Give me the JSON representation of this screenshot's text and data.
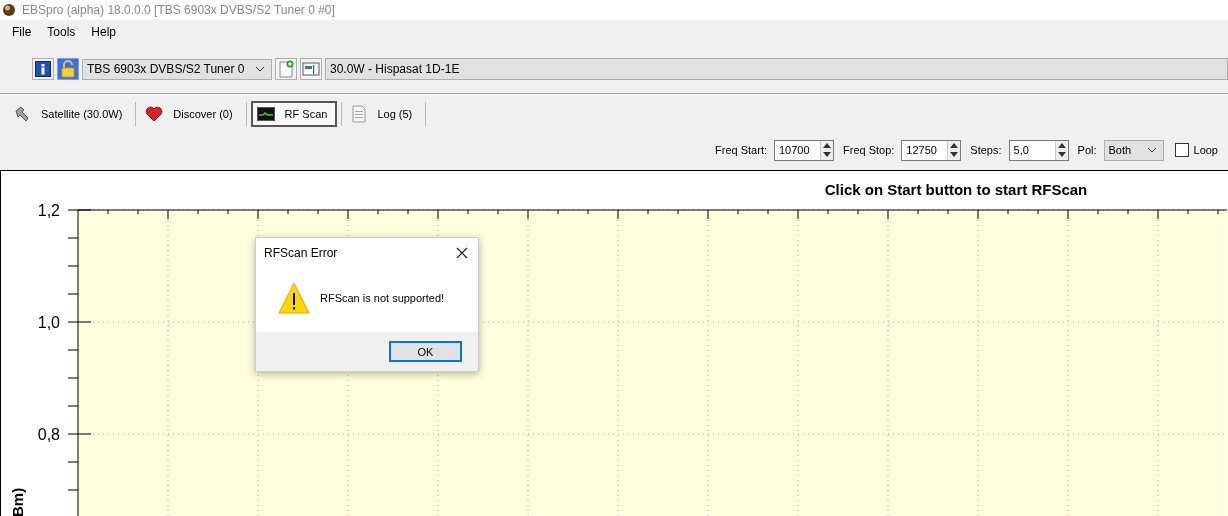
{
  "window": {
    "title": "EBSpro (alpha) 18.0.0.0 [TBS 6903x DVBS/S2 Tuner 0 #0]"
  },
  "menu": [
    "File",
    "Tools",
    "Help"
  ],
  "toolbar": {
    "buttons": [
      {
        "kind": "info",
        "on": false
      },
      {
        "kind": "lock",
        "on": true
      }
    ],
    "tuner": "TBS 6903x DVBS/S2 Tuner 0",
    "actions": [
      {
        "kind": "new"
      },
      {
        "kind": "position"
      }
    ],
    "satellite": "30.0W - Hispasat 1D-1E"
  },
  "tabs": [
    {
      "kind": "satellite",
      "label": "Satellite (30.0W)",
      "selected": false
    },
    {
      "kind": "discover",
      "label": "Discover (0)",
      "selected": false
    },
    {
      "kind": "rfscan",
      "label": "RF Scan",
      "selected": true
    },
    {
      "kind": "log",
      "label": "Log (5)",
      "selected": false
    }
  ],
  "scan_settings": {
    "fields": [
      {
        "label": "Freq Start:",
        "value": "10700"
      },
      {
        "label": "Freq Stop:",
        "value": "12750"
      },
      {
        "label": "Steps:",
        "value": "5,0"
      }
    ],
    "pol": {
      "label": "Pol:",
      "value": "Both"
    },
    "loop": {
      "label": "Loop",
      "checked": false
    }
  },
  "chart": {
    "title": "Click on Start button to start RFScan",
    "y_axis_label": "Bm)",
    "y_tick_labels": [
      "1,2",
      "1,0",
      "0,8"
    ]
  },
  "dialog": {
    "title": "RFScan Error",
    "message": "RFScan is not supported!",
    "buttons": [
      "OK"
    ]
  }
}
